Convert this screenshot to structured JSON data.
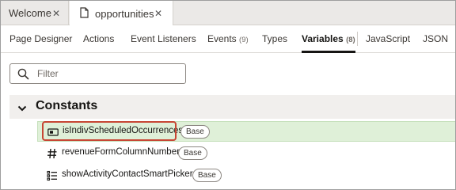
{
  "file_tabs": [
    {
      "label": "Welcome",
      "close": "✕"
    },
    {
      "label": "opportunities",
      "close": "✕"
    }
  ],
  "designer_tabs": {
    "page_designer": "Page Designer",
    "actions": "Actions",
    "event_listeners": "Event Listeners",
    "events": "Events",
    "events_count": "(9)",
    "types": "Types",
    "variables": "Variables",
    "variables_count": "(8)",
    "javascript": "JavaScript",
    "json": "JSON"
  },
  "filter": {
    "placeholder": "Filter"
  },
  "section": {
    "title": "Constants"
  },
  "rows": [
    {
      "name": "isIndivScheduledOccurrences",
      "badge": "Base",
      "icon": "boolean-icon"
    },
    {
      "name": "revenueFormColumnNumber",
      "badge": "Base",
      "icon": "number-icon"
    },
    {
      "name": "showActivityContactSmartPicker",
      "badge": "Base",
      "icon": "list-icon"
    }
  ],
  "colors": {
    "selected_row": "#dff0d8",
    "highlight_border": "#c74634",
    "active_tab_underline": "#161513"
  }
}
